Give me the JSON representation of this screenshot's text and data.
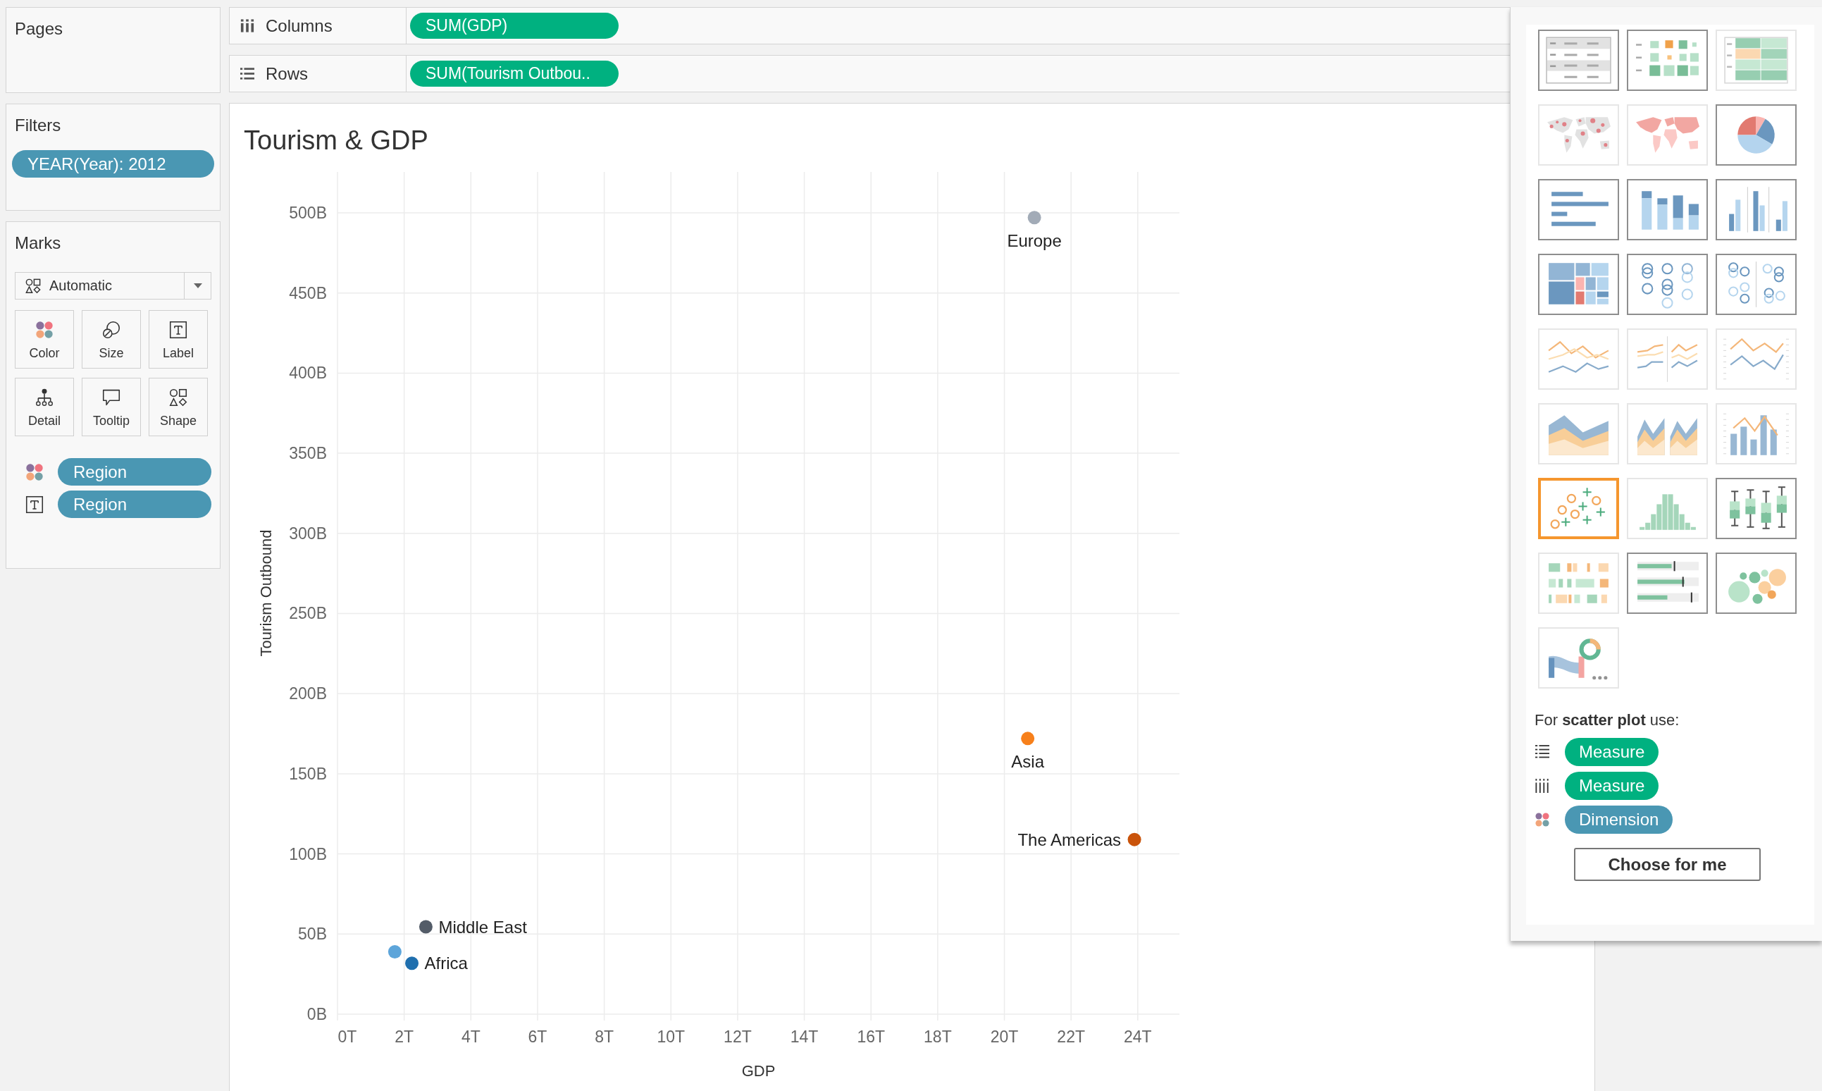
{
  "pages_panel": {
    "title": "Pages"
  },
  "filters_panel": {
    "title": "Filters",
    "pills": [
      {
        "label": "YEAR(Year): 2012"
      }
    ]
  },
  "marks_panel": {
    "title": "Marks",
    "mark_type": {
      "value": "Automatic"
    },
    "buttons": [
      {
        "label": "Color",
        "kind": "color"
      },
      {
        "label": "Size",
        "kind": "size"
      },
      {
        "label": "Label",
        "kind": "label"
      },
      {
        "label": "Detail",
        "kind": "detail"
      },
      {
        "label": "Tooltip",
        "kind": "tooltip"
      },
      {
        "label": "Shape",
        "kind": "shape"
      }
    ],
    "encodings": [
      {
        "kind": "color",
        "pill": "Region"
      },
      {
        "kind": "label",
        "pill": "Region"
      }
    ]
  },
  "shelves": [
    {
      "kind": "columns",
      "label": "Columns",
      "pill": "SUM(GDP)"
    },
    {
      "kind": "rows",
      "label": "Rows",
      "pill": "SUM(Tourism Outbou.."
    }
  ],
  "worksheet": {
    "chart_data": {
      "type": "scatter",
      "title": "Tourism & GDP",
      "xlabel": "GDP",
      "ylabel": "Tourism Outbound",
      "grid": true,
      "xlim": [
        0,
        25.25
      ],
      "ylim": [
        0,
        525.5
      ],
      "xticks": [
        {
          "value": 0,
          "label": "0T"
        },
        {
          "value": 2,
          "label": "2T"
        },
        {
          "value": 4,
          "label": "4T"
        },
        {
          "value": 6,
          "label": "6T"
        },
        {
          "value": 8,
          "label": "8T"
        },
        {
          "value": 10,
          "label": "10T"
        },
        {
          "value": 12,
          "label": "12T"
        },
        {
          "value": 14,
          "label": "14T"
        },
        {
          "value": 16,
          "label": "16T"
        },
        {
          "value": 18,
          "label": "18T"
        },
        {
          "value": 20,
          "label": "20T"
        },
        {
          "value": 22,
          "label": "22T"
        },
        {
          "value": 24,
          "label": "24T"
        }
      ],
      "yticks": [
        {
          "value": 0,
          "label": "0B"
        },
        {
          "value": 50,
          "label": "50B"
        },
        {
          "value": 100,
          "label": "100B"
        },
        {
          "value": 150,
          "label": "150B"
        },
        {
          "value": 200,
          "label": "200B"
        },
        {
          "value": 250,
          "label": "250B"
        },
        {
          "value": 300,
          "label": "300B"
        },
        {
          "value": 350,
          "label": "350B"
        },
        {
          "value": 400,
          "label": "400B"
        },
        {
          "value": 450,
          "label": "450B"
        },
        {
          "value": 500,
          "label": "500B"
        }
      ],
      "series": [
        {
          "name": "Europe",
          "color": "#a2abb7",
          "x": [
            20.9
          ],
          "values": [
            497
          ]
        },
        {
          "name": "Asia",
          "color": "#f7801b",
          "x": [
            20.7
          ],
          "values": [
            172
          ]
        },
        {
          "name": "The Americas",
          "color": "#c9530a",
          "x": [
            23.9
          ],
          "values": [
            109
          ]
        },
        {
          "name": "Middle East",
          "color": "#535c68",
          "x": [
            2.65
          ],
          "values": [
            54.5
          ]
        },
        {
          "color": "#5da5da",
          "x": [
            1.72
          ],
          "values": [
            38.9
          ]
        },
        {
          "name": "Africa",
          "color": "#1f6fae",
          "x": [
            2.23
          ],
          "values": [
            31.8
          ]
        }
      ]
    }
  },
  "show_me": {
    "chart_types": [
      {
        "kind": "texttable",
        "available": true,
        "selected": false
      },
      {
        "kind": "heatmap",
        "available": true,
        "selected": false
      },
      {
        "kind": "highlighttable",
        "available": false,
        "selected": false
      },
      {
        "kind": "symbolmap",
        "available": false,
        "selected": false
      },
      {
        "kind": "filledmap",
        "available": false,
        "selected": false
      },
      {
        "kind": "pie",
        "available": true,
        "selected": false
      },
      {
        "kind": "hbars",
        "available": true,
        "selected": false
      },
      {
        "kind": "stackedbars",
        "available": true,
        "selected": false
      },
      {
        "kind": "sidebars",
        "available": true,
        "selected": false
      },
      {
        "kind": "treemap",
        "available": true,
        "selected": false
      },
      {
        "kind": "circles",
        "available": true,
        "selected": false
      },
      {
        "kind": "sidecircles",
        "available": true,
        "selected": false
      },
      {
        "kind": "lines",
        "available": false,
        "selected": false
      },
      {
        "kind": "splitlines",
        "available": false,
        "selected": false
      },
      {
        "kind": "duallines",
        "available": false,
        "selected": false
      },
      {
        "kind": "area",
        "available": false,
        "selected": false
      },
      {
        "kind": "splitarea",
        "available": false,
        "selected": false
      },
      {
        "kind": "combo",
        "available": false,
        "selected": false
      },
      {
        "kind": "scatter",
        "available": true,
        "selected": true
      },
      {
        "kind": "histogram",
        "available": false,
        "selected": false
      },
      {
        "kind": "boxplot",
        "available": true,
        "selected": false
      },
      {
        "kind": "gantt",
        "available": false,
        "selected": false
      },
      {
        "kind": "bullet",
        "available": true,
        "selected": false
      },
      {
        "kind": "bubbles",
        "available": true,
        "selected": false
      },
      {
        "kind": "more",
        "available": false,
        "selected": false
      }
    ],
    "hint": "For **scatter plot** use:",
    "requirements": [
      {
        "kind": "rows",
        "pill": "Measure",
        "color": "#00b180"
      },
      {
        "kind": "columns",
        "pill": "Measure",
        "color": "#00b180"
      },
      {
        "kind": "color",
        "pill": "Dimension",
        "color": "#4a97b3"
      }
    ],
    "button": "Choose for me"
  }
}
